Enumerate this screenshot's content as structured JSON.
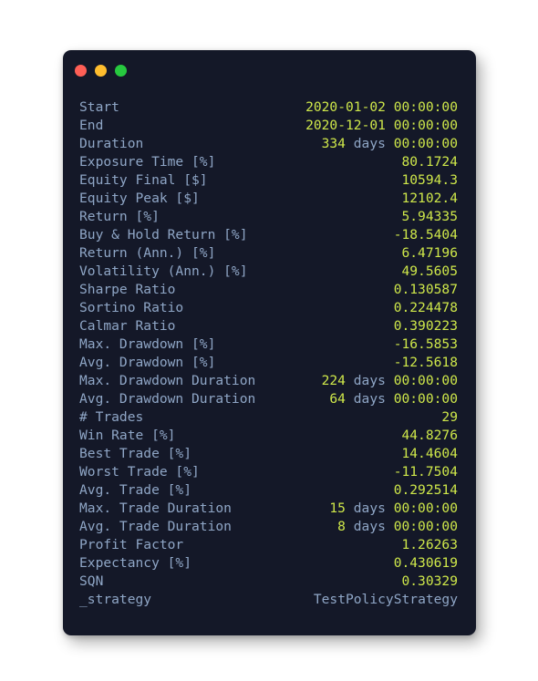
{
  "window": {
    "title": "",
    "traffic_lights": [
      {
        "name": "close",
        "color": "#ff5f56"
      },
      {
        "name": "minimize",
        "color": "#ffbd2e"
      },
      {
        "name": "maximize",
        "color": "#27c93f"
      }
    ],
    "background": "#141828",
    "label_color": "#8fa6c6",
    "value_color": "#cfe84a"
  },
  "stats": [
    {
      "label": "Start",
      "value": "2020-01-02 00:00:00",
      "kind": "datetime"
    },
    {
      "label": "End",
      "value": "2020-12-01 00:00:00",
      "kind": "datetime"
    },
    {
      "label": "Duration",
      "value": "334 days 00:00:00",
      "kind": "duration",
      "amount": "334",
      "unit": "days",
      "time": "00:00:00"
    },
    {
      "label": "Exposure Time [%]",
      "value": "80.1724",
      "kind": "number"
    },
    {
      "label": "Equity Final [$]",
      "value": "10594.3",
      "kind": "number"
    },
    {
      "label": "Equity Peak [$]",
      "value": "12102.4",
      "kind": "number"
    },
    {
      "label": "Return [%]",
      "value": "5.94335",
      "kind": "number"
    },
    {
      "label": "Buy & Hold Return [%]",
      "value": "-18.5404",
      "kind": "number"
    },
    {
      "label": "Return (Ann.) [%]",
      "value": "6.47196",
      "kind": "number"
    },
    {
      "label": "Volatility (Ann.) [%]",
      "value": "49.5605",
      "kind": "number"
    },
    {
      "label": "Sharpe Ratio",
      "value": "0.130587",
      "kind": "number"
    },
    {
      "label": "Sortino Ratio",
      "value": "0.224478",
      "kind": "number"
    },
    {
      "label": "Calmar Ratio",
      "value": "0.390223",
      "kind": "number"
    },
    {
      "label": "Max. Drawdown [%]",
      "value": "-16.5853",
      "kind": "number"
    },
    {
      "label": "Avg. Drawdown [%]",
      "value": "-12.5618",
      "kind": "number"
    },
    {
      "label": "Max. Drawdown Duration",
      "value": "224 days 00:00:00",
      "kind": "duration",
      "amount": "224",
      "unit": "days",
      "time": "00:00:00"
    },
    {
      "label": "Avg. Drawdown Duration",
      "value": "64 days 00:00:00",
      "kind": "duration",
      "amount": "64",
      "unit": "days",
      "time": "00:00:00"
    },
    {
      "label": "# Trades",
      "value": "29",
      "kind": "number"
    },
    {
      "label": "Win Rate [%]",
      "value": "44.8276",
      "kind": "number"
    },
    {
      "label": "Best Trade [%]",
      "value": "14.4604",
      "kind": "number"
    },
    {
      "label": "Worst Trade [%]",
      "value": "-11.7504",
      "kind": "number"
    },
    {
      "label": "Avg. Trade [%]",
      "value": "0.292514",
      "kind": "number"
    },
    {
      "label": "Max. Trade Duration",
      "value": "15 days 00:00:00",
      "kind": "duration",
      "amount": "15",
      "unit": "days",
      "time": "00:00:00"
    },
    {
      "label": "Avg. Trade Duration",
      "value": "8 days 00:00:00",
      "kind": "duration",
      "amount": "8",
      "unit": "days",
      "time": "00:00:00"
    },
    {
      "label": "Profit Factor",
      "value": "1.26263",
      "kind": "number"
    },
    {
      "label": "Expectancy [%]",
      "value": "0.430619",
      "kind": "number"
    },
    {
      "label": "SQN",
      "value": "0.30329",
      "kind": "number"
    },
    {
      "label": "_strategy",
      "value": "TestPolicyStrategy",
      "kind": "text"
    }
  ]
}
